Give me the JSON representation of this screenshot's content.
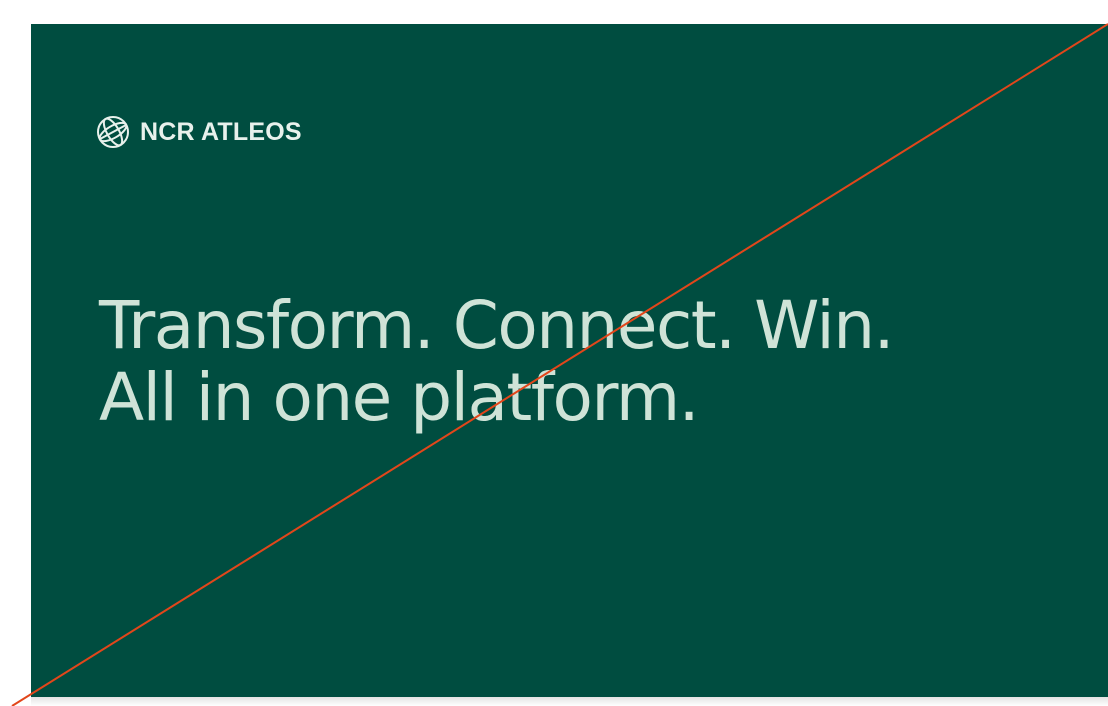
{
  "brand": {
    "name": "NCR ATLEOS",
    "logo_icon": "globe-icon"
  },
  "headline": {
    "line1": "Transform. Connect. Win.",
    "line2": "All in one platform."
  },
  "colors": {
    "background": "#004d40",
    "headline_text": "#cfe3d7",
    "brand_text": "#e8f1ec",
    "diagonal_line": "#e2461a"
  }
}
